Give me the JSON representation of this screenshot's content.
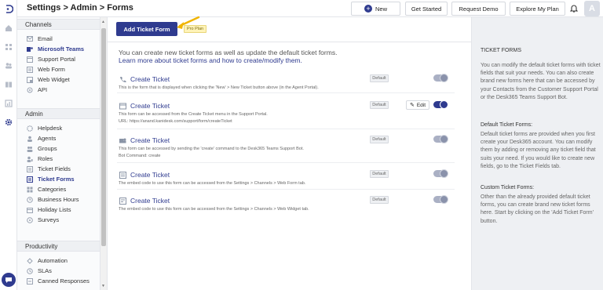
{
  "breadcrumb": "Settings > Admin > Forms",
  "topbar": {
    "new_label": "New",
    "new_icon": "plus-circle-icon",
    "get_started": "Get Started",
    "request_demo": "Request Demo",
    "explore_plan": "Explore My Plan",
    "bell_icon": "bell-icon",
    "avatar_letter": "A"
  },
  "rail": {
    "icons": [
      "logo-icon",
      "home-icon",
      "grid-icon",
      "users-icon",
      "book-icon",
      "report-icon",
      "gear-icon"
    ],
    "chat_icon": "chat-icon"
  },
  "sidebar": {
    "channels": {
      "title": "Channels",
      "items": [
        {
          "label": "Email",
          "icon": "email-icon"
        },
        {
          "label": "Microsoft Teams",
          "icon": "teams-icon",
          "active": true
        },
        {
          "label": "Support Portal",
          "icon": "portal-icon"
        },
        {
          "label": "Web Form",
          "icon": "form-icon"
        },
        {
          "label": "Web Widget",
          "icon": "widget-icon"
        },
        {
          "label": "API",
          "icon": "api-icon"
        }
      ]
    },
    "admin": {
      "title": "Admin",
      "items": [
        {
          "label": "Helpdesk",
          "icon": "helpdesk-icon"
        },
        {
          "label": "Agents",
          "icon": "agent-icon"
        },
        {
          "label": "Groups",
          "icon": "groups-icon"
        },
        {
          "label": "Roles",
          "icon": "roles-icon"
        },
        {
          "label": "Ticket Fields",
          "icon": "fields-icon"
        },
        {
          "label": "Ticket Forms",
          "icon": "forms-icon",
          "active": true
        },
        {
          "label": "Categories",
          "icon": "categories-icon"
        },
        {
          "label": "Business Hours",
          "icon": "clock-icon"
        },
        {
          "label": "Holiday Lists",
          "icon": "calendar-icon"
        },
        {
          "label": "Surveys",
          "icon": "survey-icon"
        }
      ]
    },
    "productivity": {
      "title": "Productivity",
      "items": [
        {
          "label": "Automation",
          "icon": "automation-icon"
        },
        {
          "label": "SLAs",
          "icon": "sla-icon"
        },
        {
          "label": "Canned Responses",
          "icon": "canned-icon"
        }
      ]
    }
  },
  "main": {
    "add_button": "Add Ticket Form",
    "pro_badge": "Pro Plan",
    "intro_text": "You can create new ticket forms as well as update the default ticket forms.",
    "intro_link": "Learn more about ticket forms and how to create/modify them.",
    "forms": [
      {
        "title": "Create Ticket",
        "icon": "phone-icon",
        "desc": [
          "This is the form that is displayed when clicking the 'New' > New Ticket button above (in the Agent Portal)."
        ],
        "badge": "Default",
        "toggle_on": false,
        "has_edit": false
      },
      {
        "title": "Create Ticket",
        "icon": "window-icon",
        "desc": [
          "This form can be accessed from the Create Ticket menu in the Support Portal.",
          "URL: https://anand.kanidesk.com/support/form/createTicket"
        ],
        "badge": "Default",
        "toggle_on": true,
        "has_edit": true,
        "edit_label": "Edit"
      },
      {
        "title": "Create Ticket",
        "icon": "teams-icon",
        "desc": [
          "This form can be accessed by sending the 'create' command to the Desk365 Teams Support Bot.",
          "Bot Command: create"
        ],
        "badge": "Default",
        "toggle_on": false,
        "has_edit": false
      },
      {
        "title": "Create Ticket",
        "icon": "form-icon",
        "desc": [
          "The embed code to use this form can be accessed from the Settings > Channels > Web Form tab."
        ],
        "badge": "Default",
        "toggle_on": false,
        "has_edit": false
      },
      {
        "title": "Create Ticket",
        "icon": "widget-icon",
        "desc": [
          "The embed code to use this form can be accessed from the Settings > Channels > Web Widget tab."
        ],
        "badge": "Default",
        "toggle_on": false,
        "has_edit": false
      }
    ]
  },
  "info": {
    "heading": "TICKET FORMS",
    "para1": "You can modify the default ticket forms with ticket fields that suit your needs. You can also create brand new forms here that can be accessed by your Contacts from the Customer Support Portal or the Desk365 Teams Support Bot.",
    "default_heading": "Default Ticket Forms:",
    "para2": "Default ticket forms are provided when you first create your Desk365 account. You can modify them by adding or removing any ticket field that suits your need. If you would like to create new fields, go to the Ticket Fields tab.",
    "custom_heading": "Custom Ticket Forms:",
    "para3": "Other than the already provided default ticket forms, you can create brand new ticket forms here. Start by clicking on the 'Add Ticket Form' button."
  },
  "colors": {
    "primary": "#2f3b8f",
    "arrow": "#f0b400",
    "toggle_off": "#aab0c4"
  }
}
